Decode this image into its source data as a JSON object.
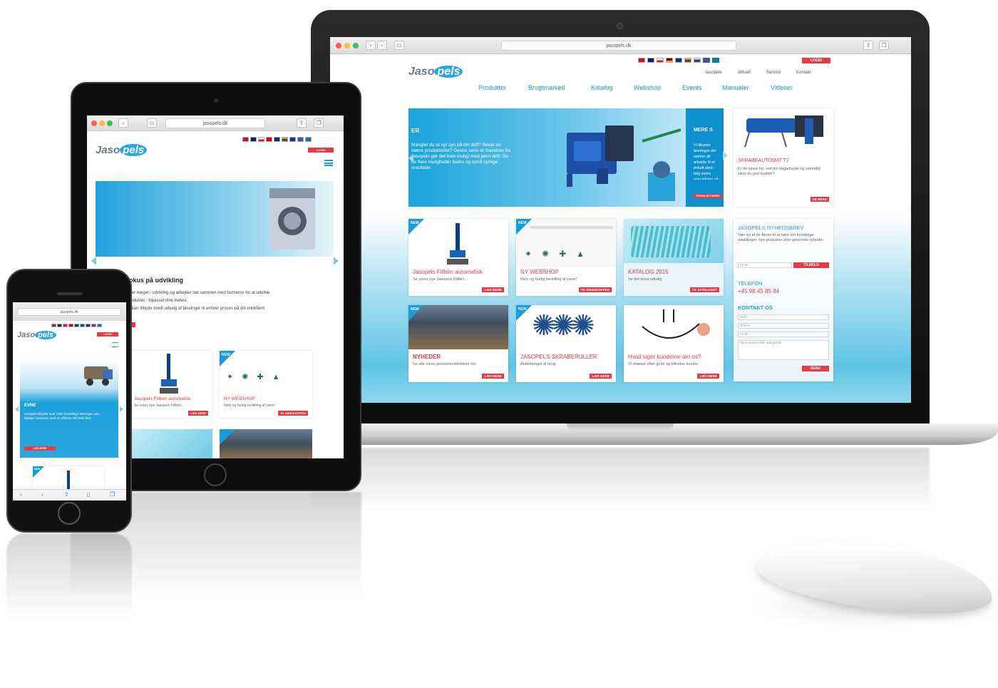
{
  "laptop": {
    "url": "jasopels.dk",
    "logo_prefix": "Jaso",
    "logo_suffix": "pels",
    "login_label": "LOGIN",
    "topmenu": [
      "Jasopels",
      "Aktuelt",
      "Service",
      "Kontakt"
    ],
    "nav": [
      "Produkter",
      "Brugtmarked",
      "Katalog",
      "Webshop",
      "Events",
      "Manualer",
      "Videoer"
    ],
    "banner": {
      "heading": "ER",
      "text": "Mangler du et nyt syn på din drift? Bevar en større produktivitet? Denne serie af maskiner fra Jasopels gør det hele muligt med jævn drift. Se de flere muligheder bedre og opnå synlige resultater.",
      "side_heading": "MERE S",
      "side_text": "Vi tilbyder løsninger der samler dit arbejde til et enkelt sted - følg vores specialister så din drift kører optimalt.",
      "side_btn": "FREMLÆS MERE"
    },
    "feature": {
      "title": "SKRABEAUTOMAT T2",
      "desc": "Er de spare tid, ved din dagarbejde og samtidig sikre en god kvalitet?",
      "more": "SE MERE"
    },
    "cards": [
      {
        "title": "Jasopels Fillbim automatisk",
        "desc": "Se vores nye Jasopels Fillbim...",
        "more": "LÆS MERE",
        "new": true
      },
      {
        "title": "NY WEBSHOP",
        "desc": "Nem og hurtig bestilling af varer!",
        "more": "TIL WEBSHOPPEN",
        "new": true
      },
      {
        "title": "KATALOG 2015",
        "desc": "Se det store udvalg",
        "more": "TIL KATALOGET",
        "new": false
      },
      {
        "title": "NYHEDER",
        "desc": "Se alle vores pressemeddelelser her",
        "more": "LÆS MERE",
        "new": true
      },
      {
        "title": "JASOPELS SKRABERULLER",
        "desc": "Anbefalinger til brug",
        "more": "LÆS MERE",
        "new": true
      },
      {
        "title": "Hvad siger kunderne om os?",
        "desc": "Vi stræber efter gode og tilfredse kunder",
        "more": "LÆS MERE",
        "new": false
      }
    ],
    "new_label": "NEW",
    "sidebar": {
      "newsletter_title": "JASOPELS NYHEDSBREV",
      "newsletter_text": "Vær en af de første til at høre om fremtidige udstillinger, nye produkter eller generelle nyheder.",
      "email_placeholder": "Email",
      "signup_btn": "TILMELD",
      "phone_title": "TELEFON",
      "phone_number": "+45 98 45 85 84",
      "contact_title": "KONTAKT OS",
      "name_placeholder": "Navn",
      "phone_placeholder": "Telefon",
      "email2_placeholder": "Email",
      "message_placeholder": "Skriv besked eller spørgsmål",
      "send_btn": "SEND"
    }
  },
  "tablet": {
    "url": "jasopels.dk",
    "logo_prefix": "Jaso",
    "logo_suffix": "pels",
    "login_label": "LOGIN",
    "heading": "fokus på udvikling",
    "text1": "Vi er meget i udvikling og arbejder tæt sammen med farmerne for at udvikle",
    "text2": "produktet - tilpasset dine behov.",
    "text3": "Vi kan tilbyde bredt udvalg af løsninger til enhver proces på din minkfarm",
    "cards": [
      {
        "title": "Jasopels Fillbim automatisk",
        "desc": "Se vores nye Jasopels Fillbim...",
        "more": "LÆS MERE"
      },
      {
        "title": "NY WEBSHOP",
        "desc": "Nem og hurtig bestilling af varer!",
        "more": "TIL WEBSHOPPEN"
      }
    ],
    "new_label": "NEW"
  },
  "phone": {
    "url": "jasopels.dk",
    "logo_prefix": "Jaso",
    "logo_suffix": "pels",
    "login_label": "LOGIN",
    "heading": "EVNE",
    "text": "Jasopels tilbyder over 1000 forskellige løsninger som hjælper farmeren med en effektiv drift hele året.",
    "btn": "LÆS MERE",
    "new_label": "NEW"
  }
}
